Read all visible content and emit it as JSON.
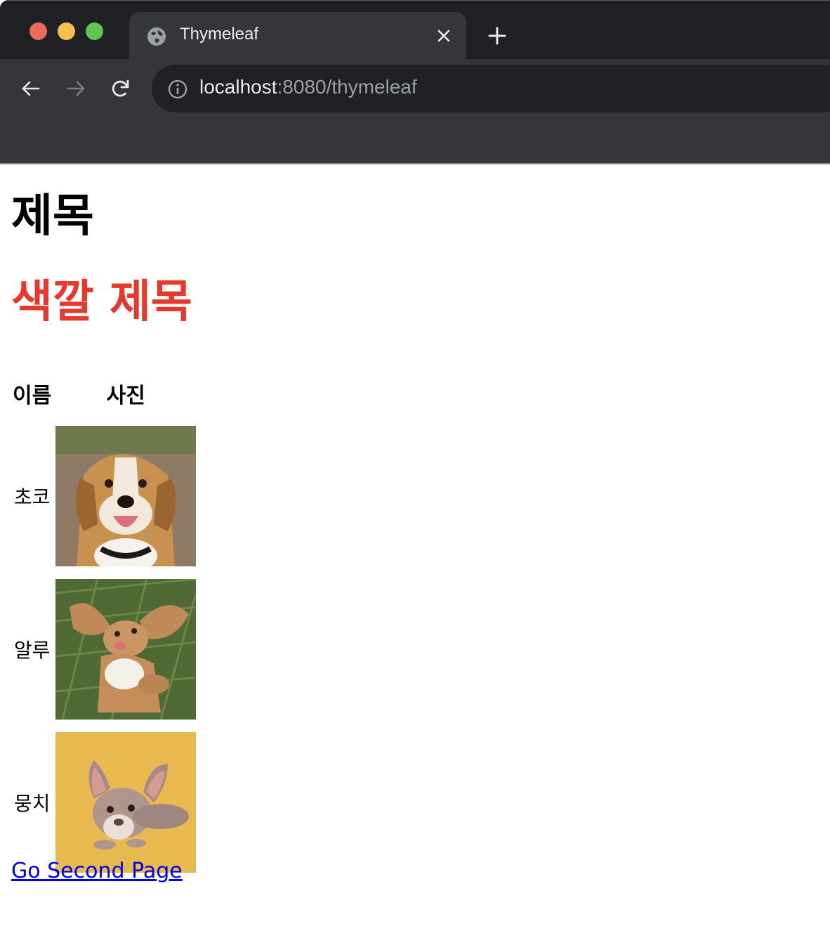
{
  "browser": {
    "tab_title": "Thymeleaf",
    "url_host": "localhost",
    "url_rest": ":8080/thymeleaf"
  },
  "page": {
    "title": "제목",
    "colored_title": "색깔 제목",
    "colored_title_color": "#e8382d",
    "table": {
      "headers": [
        "이름",
        "사진"
      ],
      "rows": [
        {
          "name": "초코",
          "photo": "beagle-dog-photo"
        },
        {
          "name": "알루",
          "photo": "spaniel-on-grass-photo"
        },
        {
          "name": "뭉치",
          "photo": "french-bulldog-photo"
        }
      ]
    },
    "link_text": "Go Second Page"
  }
}
